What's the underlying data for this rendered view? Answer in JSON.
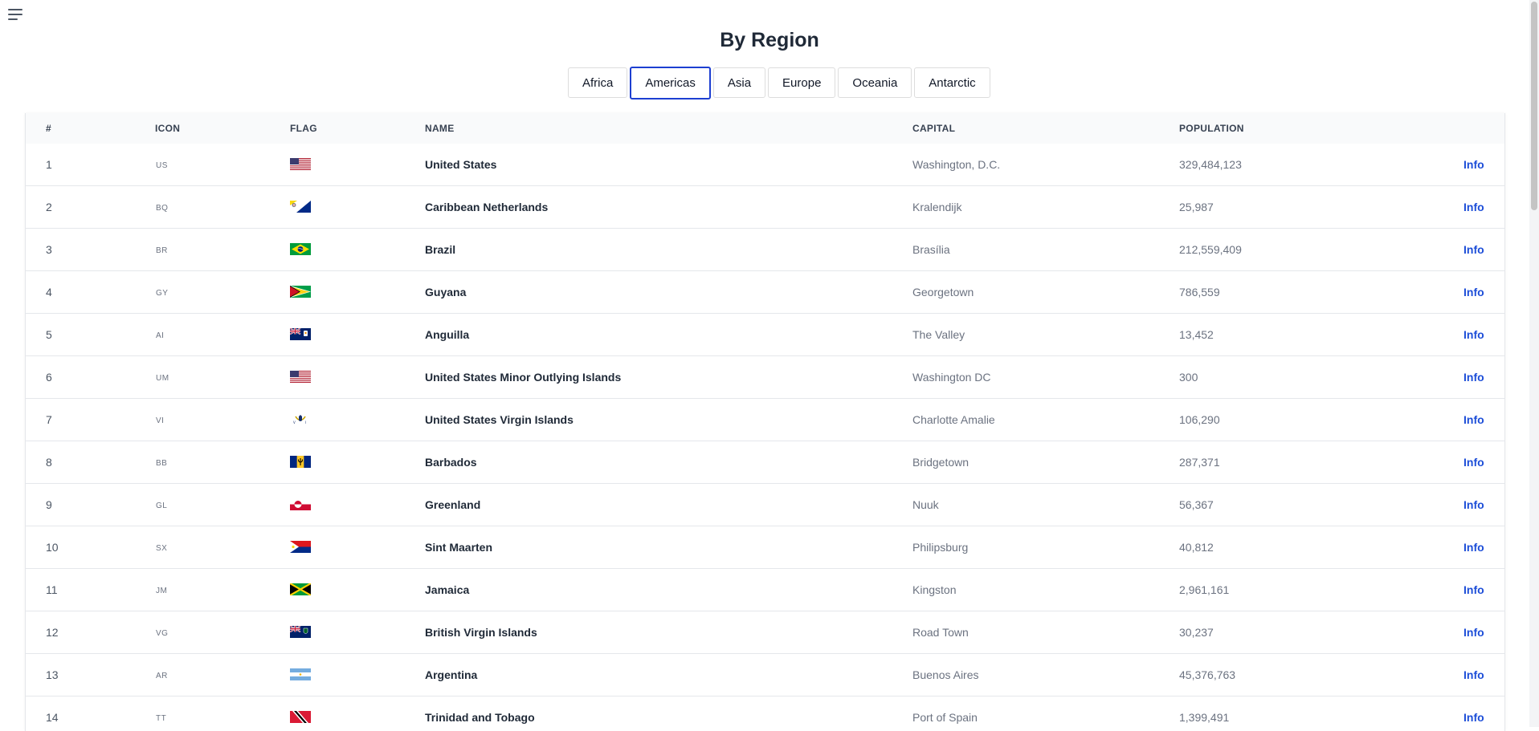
{
  "page": {
    "title": "By Region",
    "menu_icon": "hamburger-menu-icon"
  },
  "tabs": [
    {
      "label": "Africa",
      "active": false
    },
    {
      "label": "Americas",
      "active": true
    },
    {
      "label": "Asia",
      "active": false
    },
    {
      "label": "Europe",
      "active": false
    },
    {
      "label": "Oceania",
      "active": false
    },
    {
      "label": "Antarctic",
      "active": false
    }
  ],
  "table": {
    "headers": {
      "num": "#",
      "icon": "ICON",
      "flag": "FLAG",
      "name": "NAME",
      "capital": "CAPITAL",
      "population": "POPULATION"
    },
    "info_label": "Info",
    "rows": [
      {
        "num": "1",
        "code": "US",
        "flag": "us",
        "name": "United States",
        "capital": "Washington, D.C.",
        "population": "329,484,123"
      },
      {
        "num": "2",
        "code": "BQ",
        "flag": "bq",
        "name": "Caribbean Netherlands",
        "capital": "Kralendijk",
        "population": "25,987"
      },
      {
        "num": "3",
        "code": "BR",
        "flag": "br",
        "name": "Brazil",
        "capital": "Brasília",
        "population": "212,559,409"
      },
      {
        "num": "4",
        "code": "GY",
        "flag": "gy",
        "name": "Guyana",
        "capital": "Georgetown",
        "population": "786,559"
      },
      {
        "num": "5",
        "code": "AI",
        "flag": "ai",
        "name": "Anguilla",
        "capital": "The Valley",
        "population": "13,452"
      },
      {
        "num": "6",
        "code": "UM",
        "flag": "us",
        "name": "United States Minor Outlying Islands",
        "capital": "Washington DC",
        "population": "300"
      },
      {
        "num": "7",
        "code": "VI",
        "flag": "vi",
        "name": "United States Virgin Islands",
        "capital": "Charlotte Amalie",
        "population": "106,290"
      },
      {
        "num": "8",
        "code": "BB",
        "flag": "bb",
        "name": "Barbados",
        "capital": "Bridgetown",
        "population": "287,371"
      },
      {
        "num": "9",
        "code": "GL",
        "flag": "gl",
        "name": "Greenland",
        "capital": "Nuuk",
        "population": "56,367"
      },
      {
        "num": "10",
        "code": "SX",
        "flag": "sx",
        "name": "Sint Maarten",
        "capital": "Philipsburg",
        "population": "40,812"
      },
      {
        "num": "11",
        "code": "JM",
        "flag": "jm",
        "name": "Jamaica",
        "capital": "Kingston",
        "population": "2,961,161"
      },
      {
        "num": "12",
        "code": "VG",
        "flag": "vg",
        "name": "British Virgin Islands",
        "capital": "Road Town",
        "population": "30,237"
      },
      {
        "num": "13",
        "code": "AR",
        "flag": "ar",
        "name": "Argentina",
        "capital": "Buenos Aires",
        "population": "45,376,763"
      },
      {
        "num": "14",
        "code": "TT",
        "flag": "tt",
        "name": "Trinidad and Tobago",
        "capital": "Port of Spain",
        "population": "1,399,491"
      }
    ]
  },
  "colors": {
    "accent": "#1d3fd1",
    "link": "#1d4ed8",
    "header_bg": "#f9fafb",
    "row_border": "#e5e7eb"
  }
}
